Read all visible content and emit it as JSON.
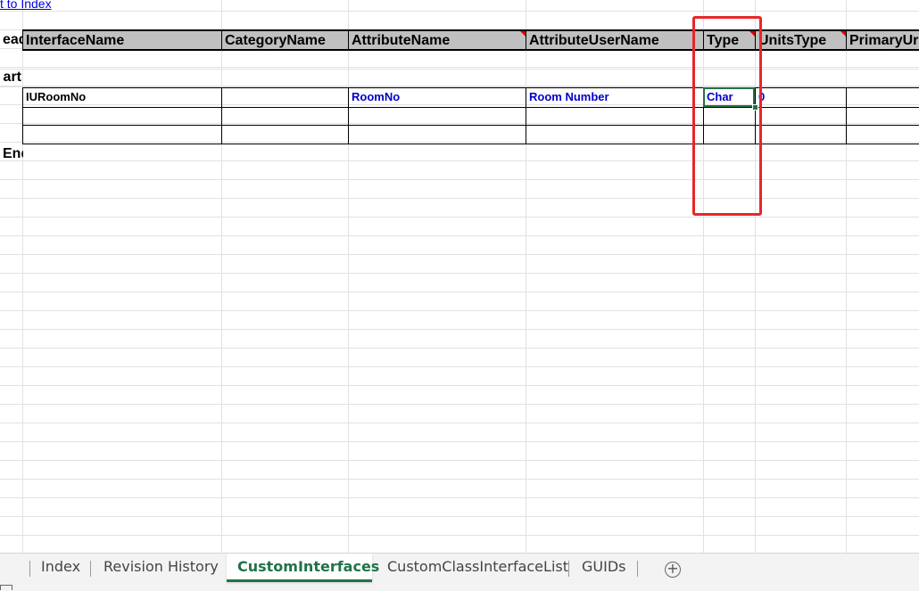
{
  "link": {
    "text": "t to Index"
  },
  "row_labels": {
    "head": "ead",
    "start": "art",
    "end": "End"
  },
  "headers": [
    "InterfaceName",
    "CategoryName",
    "AttributeName",
    "AttributeUserName",
    "Type",
    "UnitsType",
    "PrimaryUr"
  ],
  "rows": [
    [
      "IURoomNo",
      "",
      "RoomNo",
      "Room Number",
      "Char",
      "0",
      ""
    ],
    [
      "",
      "",
      "",
      "",
      "",
      "",
      ""
    ],
    [
      "",
      "",
      "",
      "",
      "",
      "",
      ""
    ]
  ],
  "tabs": [
    {
      "label": "Index",
      "active": false
    },
    {
      "label": "Revision History",
      "active": false
    },
    {
      "label": "CustomInterfaces",
      "active": true
    },
    {
      "label": "CustomClassInterfaceList",
      "active": false
    },
    {
      "label": "GUIDs",
      "active": false
    }
  ],
  "add_sheet_symbol": "+",
  "colors": {
    "accent": "#217346",
    "header_bg": "#c0c0c0",
    "highlight_box": "#e8262a",
    "data_blue": "#0000cc"
  },
  "icons": [
    "add-sheet-icon",
    "comment-indicator-icon"
  ]
}
